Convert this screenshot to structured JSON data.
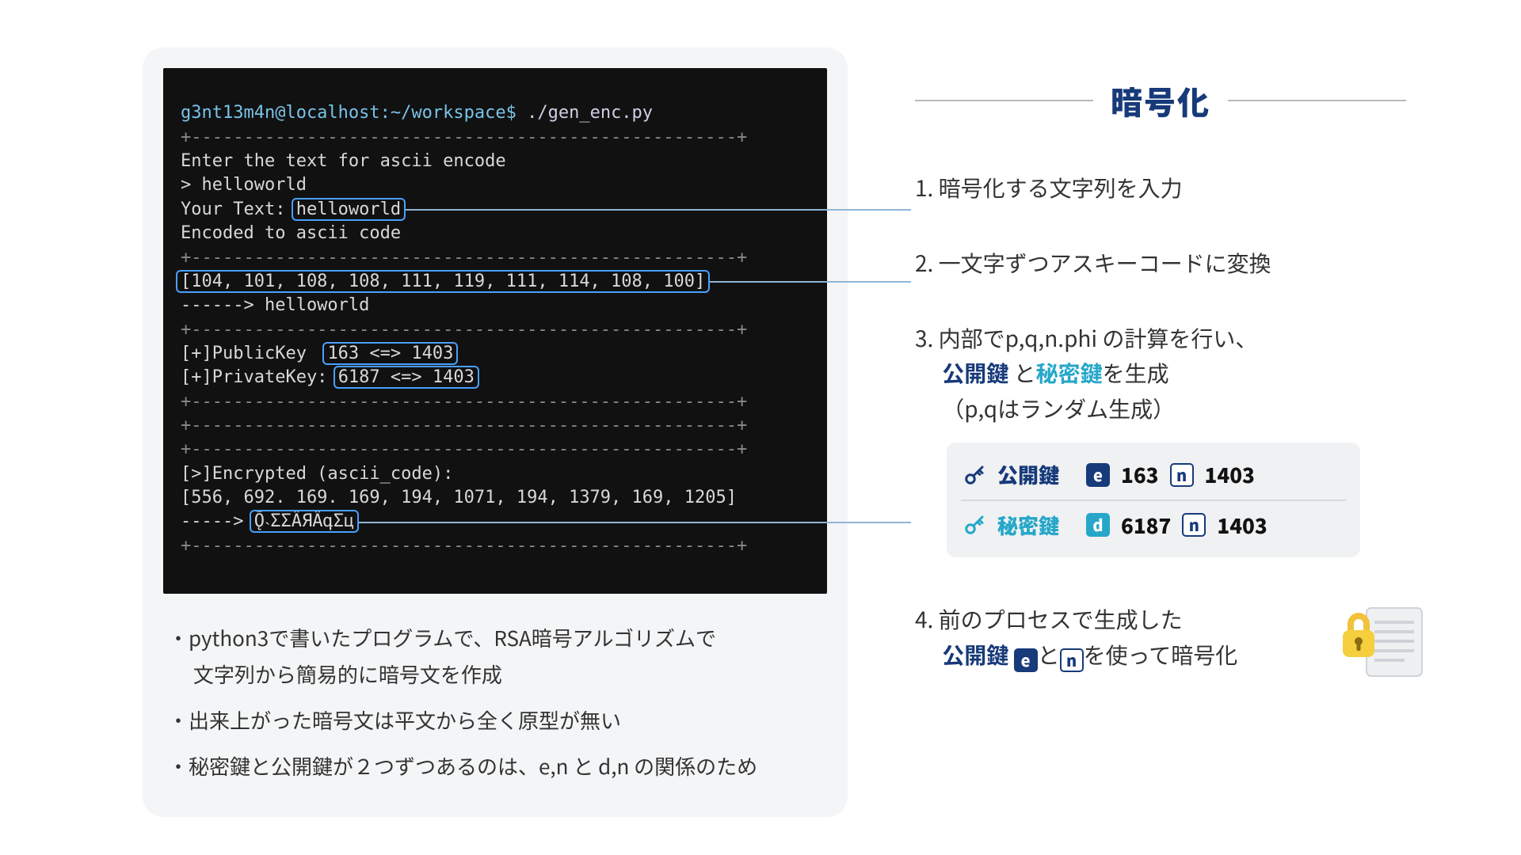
{
  "colors": {
    "navy": "#0d2a66",
    "cyan": "#26a7c9",
    "hl": "#4aa0ff"
  },
  "terminal": {
    "prompt_user": "g3nt13m4n@localhost",
    "prompt_path": ":~/workspace$",
    "cmd": " ./gen_enc.py",
    "sep": "+----------------------------------------------------+",
    "ask": "Enter the text for ascii encode",
    "input_marker": "> ",
    "input_text": "helloworld",
    "yourtext_lbl": "Your Text: ",
    "yourtext_val": "helloworld",
    "encoded_lbl": "Encoded to ascii code",
    "ascii_list": "[104, 101, 108, 108, 111, 119, 111, 114, 108, 100]",
    "ascii_arrow": "------> helloworld",
    "pubkey_lbl": "[+]PublicKey  ",
    "pubkey_val": "163 <=> 1403",
    "privkey_lbl": "[+]PrivateKey: ",
    "privkey_val": "6187 <=> 1403",
    "enc_lbl": "[>]Encrypted (ascii_code):",
    "enc_list": "[556, 692. 169. 169, 194, 1071, 194, 1379, 169, 1205]",
    "enc_arrow_pre": "-----> ",
    "enc_garbled": "Ǭ˴ƩƩÂЯÂգƩц"
  },
  "notes": {
    "l1": "・python3で書いたプログラムで、RSA暗号アルゴリズムで",
    "l1b": "　 文字列から簡易的に暗号文を作成",
    "l2": "・出来上がった暗号文は平文から全く原型が無い",
    "l3": "・秘密鍵と公開鍵が２つずつあるのは、e,n と d,n の関係のため"
  },
  "right": {
    "title": "暗号化",
    "s1": "1. 暗号化する文字列を入力",
    "s2": "2. 一文字ずつアスキーコードに変換",
    "s3a": "3. 内部でp,q,n.phi の計算を行い、",
    "s3b_pre": "　 ",
    "s3b_pub": "公開鍵",
    "s3b_mid": " と",
    "s3b_priv": "秘密鍵",
    "s3b_post": "を生成",
    "s3c": "　 （p,qはランダム生成）",
    "s4a": "4. 前のプロセスで生成した",
    "s4b_pre": "　 ",
    "s4b_pub": "公開鍵",
    "s4b_mid1": " ",
    "s4b_mid2": "と",
    "s4b_post": "を使って暗号化",
    "keycard": {
      "pub_label": "公開鍵",
      "priv_label": "秘密鍵",
      "e_chip": "e",
      "d_chip": "d",
      "n_chip": "n",
      "e_val": "163",
      "n_val": "1403",
      "d_val": "6187",
      "n_val2": "1403"
    }
  }
}
